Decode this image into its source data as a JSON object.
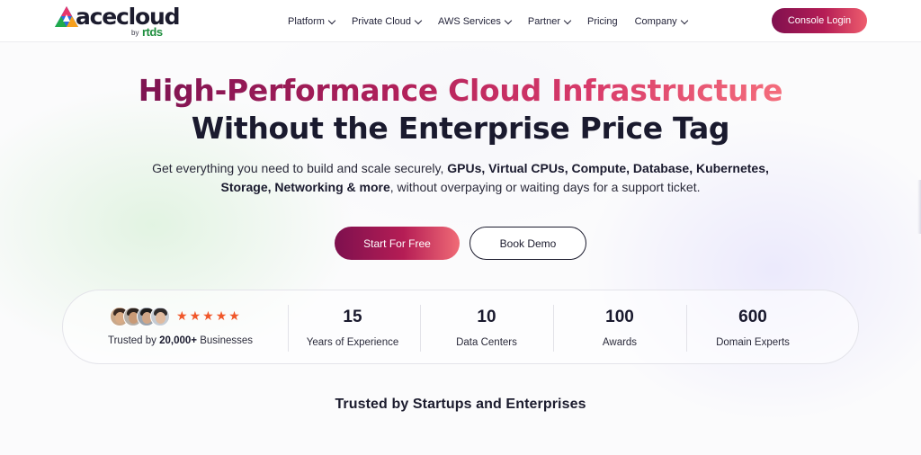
{
  "brand": {
    "logo_text": "acecloud",
    "logo_by": "by",
    "logo_sub": "rtds"
  },
  "nav": {
    "items": [
      {
        "label": "Platform",
        "has_dropdown": true
      },
      {
        "label": "Private Cloud",
        "has_dropdown": true
      },
      {
        "label": "AWS Services",
        "has_dropdown": true
      },
      {
        "label": "Partner",
        "has_dropdown": true
      },
      {
        "label": "Pricing",
        "has_dropdown": false
      },
      {
        "label": "Company",
        "has_dropdown": true
      }
    ],
    "console_login": "Console Login"
  },
  "hero": {
    "title_line1": "High-Performance Cloud Infrastructure",
    "title_line2": "Without the Enterprise Price Tag",
    "subtitle_start": "Get everything you need to build and scale securely, ",
    "subtitle_bold": "GPUs, Virtual CPUs, Compute, Database, Kubernetes, Storage, Networking & more",
    "subtitle_end": ", without overpaying or waiting days for a support ticket.",
    "cta_primary": "Start For Free",
    "cta_secondary": "Book Demo"
  },
  "trust": {
    "prefix": "Trusted by ",
    "count": "20,000+",
    "suffix": " Businesses",
    "rating_stars": 5,
    "star_glyph": "★",
    "avatar_count": 4
  },
  "stats": [
    {
      "value": "15",
      "label": "Years of Experience"
    },
    {
      "value": "10",
      "label": "Data Centers"
    },
    {
      "value": "100",
      "label": "Awards"
    },
    {
      "value": "600",
      "label": "Domain Experts"
    }
  ],
  "section": {
    "trusted_title": "Trusted by Startups and Enterprises"
  },
  "colors": {
    "accent_start": "#7d104e",
    "accent_end": "#f06b76",
    "star": "#f0572a",
    "logo_green": "#1e8e3e"
  }
}
